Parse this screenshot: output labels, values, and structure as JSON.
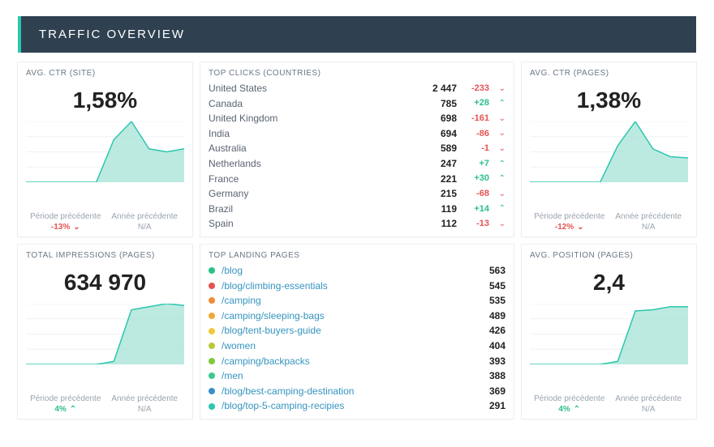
{
  "header_title": "TRAFFIC OVERVIEW",
  "labels": {
    "prev_period": "Période précédente",
    "prev_year": "Année précédente",
    "na": "N/A"
  },
  "cards": {
    "ctr_site": {
      "title": "AVG. CTR (SITE)",
      "value": "1,58%",
      "prev": "-13%",
      "prev_dir": "down"
    },
    "ctr_pages": {
      "title": "AVG. CTR (PAGES)",
      "value": "1,38%",
      "prev": "-12%",
      "prev_dir": "down"
    },
    "impressions": {
      "title": "TOTAL IMPRESSIONS (PAGES)",
      "value": "634 970",
      "prev": "4%",
      "prev_dir": "up"
    },
    "position": {
      "title": "AVG. POSITION (PAGES)",
      "value": "2,4",
      "prev": "4%",
      "prev_dir": "up"
    }
  },
  "top_clicks": {
    "title": "TOP CLICKS (COUNTRIES)",
    "rows": [
      {
        "name": "United States",
        "value": "2 447",
        "delta": "-233",
        "dir": "down"
      },
      {
        "name": "Canada",
        "value": "785",
        "delta": "+28",
        "dir": "up"
      },
      {
        "name": "United Kingdom",
        "value": "698",
        "delta": "-161",
        "dir": "down"
      },
      {
        "name": "India",
        "value": "694",
        "delta": "-86",
        "dir": "down"
      },
      {
        "name": "Australia",
        "value": "589",
        "delta": "-1",
        "dir": "down"
      },
      {
        "name": "Netherlands",
        "value": "247",
        "delta": "+7",
        "dir": "up"
      },
      {
        "name": "France",
        "value": "221",
        "delta": "+30",
        "dir": "up"
      },
      {
        "name": "Germany",
        "value": "215",
        "delta": "-68",
        "dir": "down"
      },
      {
        "name": "Brazil",
        "value": "119",
        "delta": "+14",
        "dir": "up"
      },
      {
        "name": "Spain",
        "value": "112",
        "delta": "-13",
        "dir": "down"
      }
    ]
  },
  "landing_pages": {
    "title": "TOP LANDING PAGES",
    "rows": [
      {
        "color": "#2bbf8a",
        "name": "/blog",
        "value": "563"
      },
      {
        "color": "#e55353",
        "name": "/blog/climbing-essentials",
        "value": "545"
      },
      {
        "color": "#f08c3a",
        "name": "/camping",
        "value": "535"
      },
      {
        "color": "#f0a83a",
        "name": "/camping/sleeping-bags",
        "value": "489"
      },
      {
        "color": "#f0c93a",
        "name": "/blog/tent-buyers-guide",
        "value": "426"
      },
      {
        "color": "#b7c93a",
        "name": "/women",
        "value": "404"
      },
      {
        "color": "#7fc93a",
        "name": "/camping/backpacks",
        "value": "393"
      },
      {
        "color": "#3ac98e",
        "name": "/men",
        "value": "388"
      },
      {
        "color": "#3a8ec9",
        "name": "/blog/best-camping-destination",
        "value": "369"
      },
      {
        "color": "#2dc6b0",
        "name": "/blog/top-5-camping-recipies",
        "value": "291"
      }
    ]
  },
  "chart_data": [
    {
      "type": "area",
      "title": "AVG. CTR (SITE)",
      "x": [
        0,
        1,
        2,
        3,
        4,
        5,
        6,
        7,
        8,
        9
      ],
      "values": [
        0,
        0,
        0,
        0,
        0,
        0.7,
        1.0,
        0.55,
        0.5,
        0.55
      ],
      "ylim": [
        0,
        1
      ]
    },
    {
      "type": "area",
      "title": "AVG. CTR (PAGES)",
      "x": [
        0,
        1,
        2,
        3,
        4,
        5,
        6,
        7,
        8,
        9
      ],
      "values": [
        0,
        0,
        0,
        0,
        0,
        0.6,
        1.0,
        0.55,
        0.42,
        0.4
      ],
      "ylim": [
        0,
        1
      ]
    },
    {
      "type": "area",
      "title": "TOTAL IMPRESSIONS (PAGES)",
      "x": [
        0,
        1,
        2,
        3,
        4,
        5,
        6,
        7,
        8,
        9
      ],
      "values": [
        0,
        0,
        0,
        0,
        0,
        0.05,
        0.9,
        0.95,
        1.0,
        0.97
      ],
      "ylim": [
        0,
        1
      ]
    },
    {
      "type": "area",
      "title": "AVG. POSITION (PAGES)",
      "x": [
        0,
        1,
        2,
        3,
        4,
        5,
        6,
        7,
        8,
        9
      ],
      "values": [
        0,
        0,
        0,
        0,
        0,
        0.05,
        0.88,
        0.9,
        0.95,
        0.95
      ],
      "ylim": [
        0,
        1
      ]
    }
  ]
}
